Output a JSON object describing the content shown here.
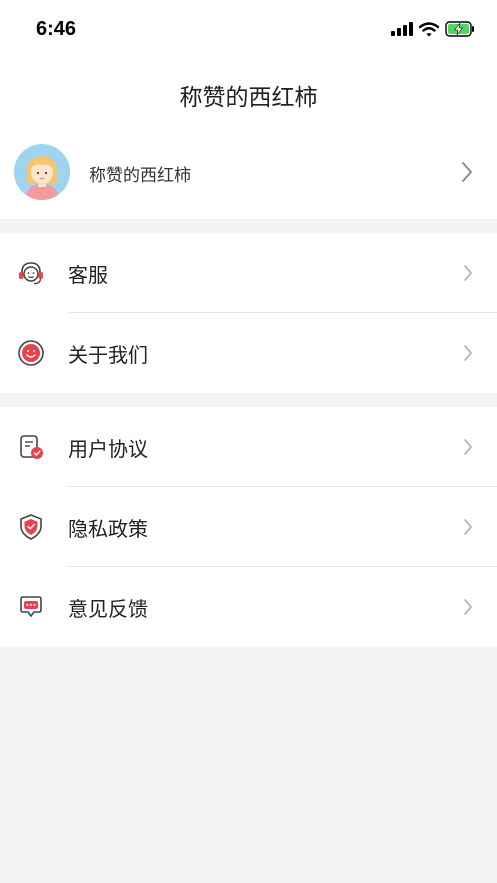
{
  "status_bar": {
    "time": "6:46"
  },
  "header": {
    "title": "称赞的西红柿"
  },
  "profile": {
    "name": "称赞的西红柿"
  },
  "menu_group_1": [
    {
      "label": "客服",
      "icon": "headset-icon"
    },
    {
      "label": "关于我们",
      "icon": "smiley-icon"
    }
  ],
  "menu_group_2": [
    {
      "label": "用户协议",
      "icon": "document-check-icon"
    },
    {
      "label": "隐私政策",
      "icon": "shield-check-icon"
    },
    {
      "label": "意见反馈",
      "icon": "message-icon"
    }
  ],
  "colors": {
    "accent": "#e8424b",
    "icon_gray": "#444444",
    "background": "#f4f4f4"
  }
}
